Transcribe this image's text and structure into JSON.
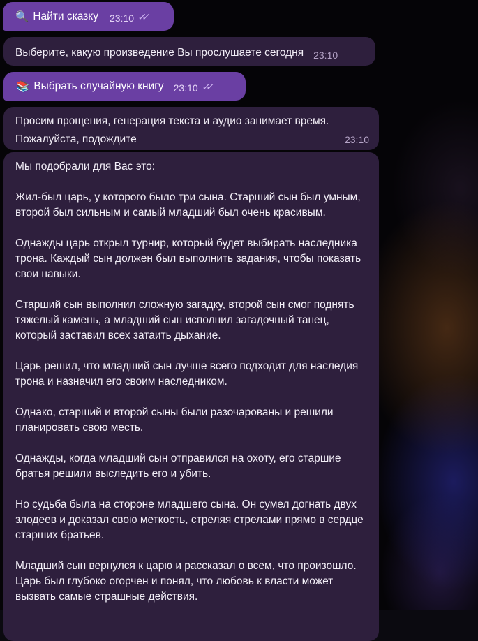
{
  "colors": {
    "outgoing_bubble": "#6a3fa3",
    "incoming_bubble": "#2e1f3d",
    "read_checks": "#cfb6f2"
  },
  "messages": [
    {
      "type": "outgoing",
      "icon": "magnifier-icon",
      "text": "Найти сказку",
      "time": "23:10",
      "status": "read"
    },
    {
      "type": "incoming",
      "text": "Выберите, какую произведение Вы прослушаете сегодня",
      "time": "23:10"
    },
    {
      "type": "outgoing",
      "icon": "books-icon",
      "text": "Выбрать случайную книгу",
      "time": "23:10",
      "status": "read"
    },
    {
      "type": "incoming",
      "text_line1": "Просим прощения, генерация текста и аудио занимает время.",
      "text_line2": "Пожалуйста, подождите",
      "time": "23:10"
    },
    {
      "type": "incoming",
      "paragraphs": [
        "Мы подобрали для Вас это:",
        "Жил-был царь, у которого было три сына. Старший сын был умным, второй был сильным и самый младший был очень красивым.",
        "Однажды царь открыл турнир, который будет выбирать наследника трона. Каждый сын должен был выполнить задания, чтобы показать свои навыки.",
        "Старший сын выполнил сложную загадку, второй сын смог поднять тяжелый камень, а младший сын исполнил загадочный танец, который заставил всех затаить дыхание.",
        "Царь решил, что младший сын лучше всего подходит для наследия трона и назначил его своим наследником.",
        "Однако, старший и второй сыны были разочарованы и решили планировать свою месть.",
        "Однажды, когда младший сын отправился на охоту, его старшие братья решили выследить его и убить.",
        "Но судьба была на стороне младшего сына. Он сумел догнать двух злодеев и доказал свою меткость, стреляя стрелами прямо в сердце старших братьев.",
        "Младший сын вернулся к царю и рассказал о всем, что произошло. Царь был глубоко огорчен и понял, что любовь к власти может вызвать самые страшные действия."
      ]
    }
  ]
}
